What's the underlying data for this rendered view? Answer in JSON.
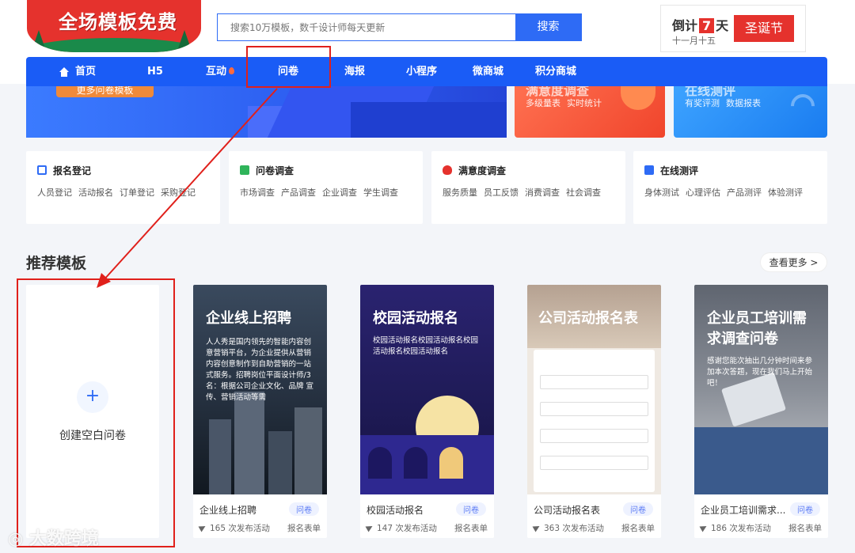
{
  "logo": {
    "text": "全场模板免费"
  },
  "search": {
    "placeholder": "搜索10万模板，数千设计师每天更新",
    "button_label": "搜索"
  },
  "countdown": {
    "prefix": "倒计",
    "days": "7",
    "unit": "天",
    "date": "十一月十五",
    "event_button": "圣诞节"
  },
  "nav": {
    "items": [
      {
        "label": "首页",
        "icon": "home-icon"
      },
      {
        "label": "H5"
      },
      {
        "label": "互动",
        "icon": "fire-icon"
      },
      {
        "label": "问卷"
      },
      {
        "label": "海报"
      },
      {
        "label": "小程序"
      },
      {
        "label": "微商城"
      },
      {
        "label": "积分商城"
      }
    ]
  },
  "banners": {
    "main_button": "更多问卷模板",
    "satisfaction": {
      "title": "满意度调查",
      "tags": [
        "多级量表",
        "实时统计"
      ]
    },
    "online_test": {
      "title": "在线测评",
      "tags": [
        "有奖评测",
        "数据报表"
      ]
    }
  },
  "categories": [
    {
      "title": "报名登记",
      "icon": "edit-icon",
      "icon_color": "#2e6bf5",
      "links": [
        "人员登记",
        "活动报名",
        "订单登记",
        "采购登记"
      ]
    },
    {
      "title": "问卷调查",
      "icon": "check-icon",
      "icon_color": "#2fb45a",
      "links": [
        "市场调查",
        "产品调查",
        "企业调查",
        "学生调查"
      ]
    },
    {
      "title": "满意度调查",
      "icon": "heart-icon",
      "icon_color": "#e5322d",
      "links": [
        "服务质量",
        "员工反馈",
        "消费调查",
        "社会调查"
      ]
    },
    {
      "title": "在线测评",
      "icon": "pulse-icon",
      "icon_color": "#2e6bf5",
      "links": [
        "身体测试",
        "心理评估",
        "产品测评",
        "体验测评"
      ]
    }
  ],
  "recommend": {
    "title": "推荐模板",
    "see_more": "查看更多 >",
    "blank_label": "创建空白问卷",
    "templates": [
      {
        "img_title": "企业线上招聘",
        "img_desc": "人人秀是国内领先的智能内容创意营销平台，为企业提供从营销内容创意制作到自助营销的一站式服务。招聘岗位平面设计师/3名：根据公司企业文化、品牌 宣传、营销活动等需",
        "name": "企业线上招聘",
        "tag": "问卷",
        "count": "165 次发布活动",
        "type": "报名表单"
      },
      {
        "img_title": "校园活动报名",
        "img_desc": "校园活动报名校园活动报名校园活动报名校园活动报名",
        "name": "校园活动报名",
        "tag": "问卷",
        "count": "147 次发布活动",
        "type": "报名表单"
      },
      {
        "img_title": "公司活动报名表",
        "img_desc": "公司活动报名表",
        "name": "公司活动报名表",
        "tag": "问卷",
        "count": "363 次发布活动",
        "type": "报名表单"
      },
      {
        "img_title": "企业员工培训需求调查问卷",
        "img_desc": "感谢您能次抽出几分钟时间来参加本次答题，现在我们马上开始吧！",
        "name": "企业员工培训需求...",
        "tag": "问卷",
        "count": "186 次发布活动",
        "type": "报名表单"
      }
    ]
  },
  "watermark": "大数跨境",
  "colors": {
    "primary": "#2e6bf5",
    "nav": "#1a5cf6",
    "red": "#e5322d",
    "annotation": "#e0201b"
  }
}
